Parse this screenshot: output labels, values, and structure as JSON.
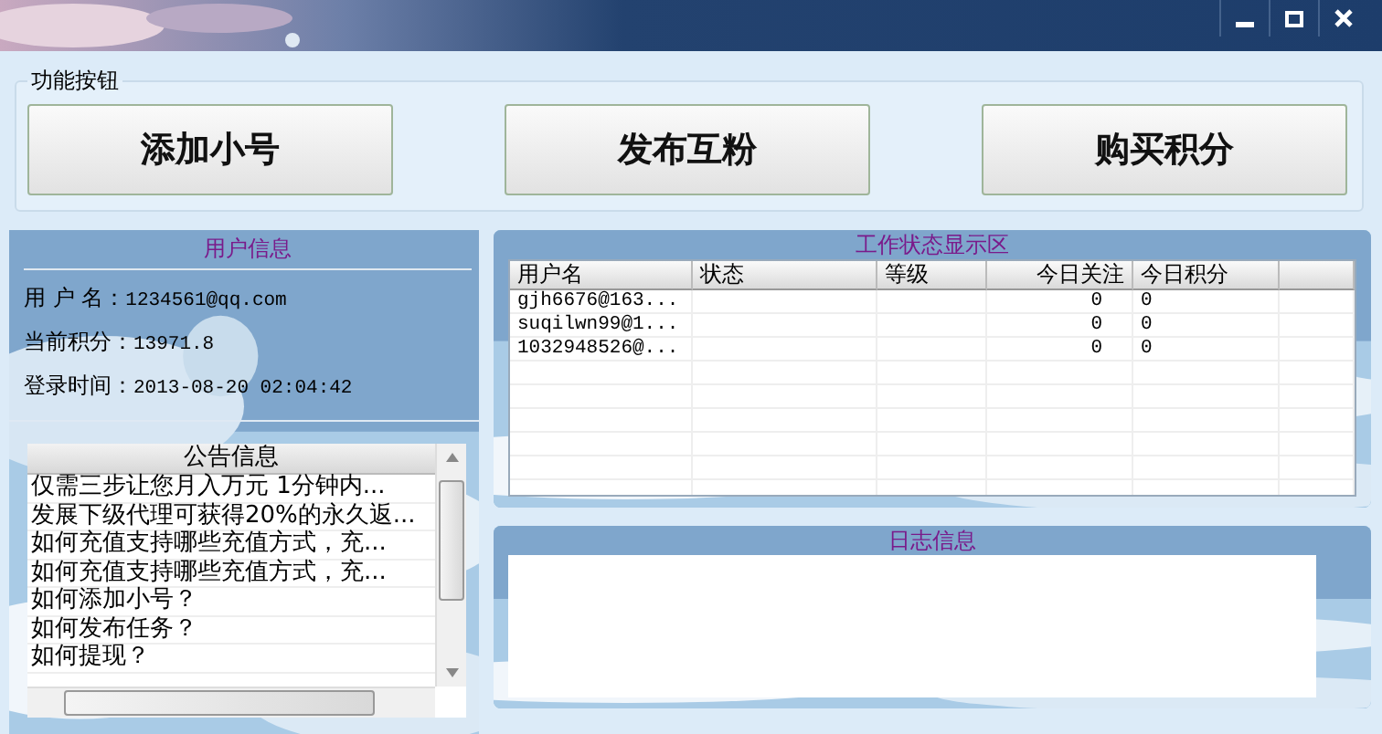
{
  "function_group": {
    "title": "功能按钮",
    "buttons": [
      "添加小号",
      "发布互粉",
      "购买积分"
    ]
  },
  "user_info": {
    "title": "用户信息",
    "fields": [
      {
        "label": "用 户 名：",
        "value": "1234561@qq.com"
      },
      {
        "label": "当前积分：",
        "value": "13971.8"
      },
      {
        "label": "登录时间：",
        "value": "2013-08-20 02:04:42"
      }
    ]
  },
  "notices": {
    "title": "公告信息",
    "items": [
      "仅需三步让您月入万元 1分钟内...",
      "发展下级代理可获得20%的永久返...",
      "如何充值支持哪些充值方式，充...",
      "如何充值支持哪些充值方式，充...",
      "如何添加小号？",
      "如何发布任务？",
      "如何提现？"
    ]
  },
  "work_status": {
    "title": "工作状态显示区",
    "columns": [
      "用户名",
      "状态",
      "等级",
      "今日关注",
      "今日积分"
    ],
    "rows": [
      {
        "username": "gjh6676@163...",
        "today_follow": "0",
        "today_points": "0"
      },
      {
        "username": "suqilwn99@1...",
        "today_follow": "0",
        "today_points": "0"
      },
      {
        "username": "1032948526@...",
        "today_follow": "0",
        "today_points": "0"
      }
    ]
  },
  "log": {
    "title": "日志信息"
  }
}
